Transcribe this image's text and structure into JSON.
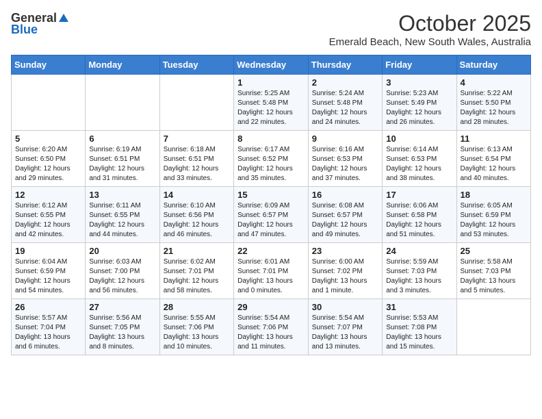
{
  "logo": {
    "general": "General",
    "blue": "Blue"
  },
  "title": {
    "month": "October 2025",
    "location": "Emerald Beach, New South Wales, Australia"
  },
  "headers": [
    "Sunday",
    "Monday",
    "Tuesday",
    "Wednesday",
    "Thursday",
    "Friday",
    "Saturday"
  ],
  "weeks": [
    [
      {
        "day": "",
        "info": ""
      },
      {
        "day": "",
        "info": ""
      },
      {
        "day": "",
        "info": ""
      },
      {
        "day": "1",
        "info": "Sunrise: 5:25 AM\nSunset: 5:48 PM\nDaylight: 12 hours\nand 22 minutes."
      },
      {
        "day": "2",
        "info": "Sunrise: 5:24 AM\nSunset: 5:48 PM\nDaylight: 12 hours\nand 24 minutes."
      },
      {
        "day": "3",
        "info": "Sunrise: 5:23 AM\nSunset: 5:49 PM\nDaylight: 12 hours\nand 26 minutes."
      },
      {
        "day": "4",
        "info": "Sunrise: 5:22 AM\nSunset: 5:50 PM\nDaylight: 12 hours\nand 28 minutes."
      }
    ],
    [
      {
        "day": "5",
        "info": "Sunrise: 6:20 AM\nSunset: 6:50 PM\nDaylight: 12 hours\nand 29 minutes."
      },
      {
        "day": "6",
        "info": "Sunrise: 6:19 AM\nSunset: 6:51 PM\nDaylight: 12 hours\nand 31 minutes."
      },
      {
        "day": "7",
        "info": "Sunrise: 6:18 AM\nSunset: 6:51 PM\nDaylight: 12 hours\nand 33 minutes."
      },
      {
        "day": "8",
        "info": "Sunrise: 6:17 AM\nSunset: 6:52 PM\nDaylight: 12 hours\nand 35 minutes."
      },
      {
        "day": "9",
        "info": "Sunrise: 6:16 AM\nSunset: 6:53 PM\nDaylight: 12 hours\nand 37 minutes."
      },
      {
        "day": "10",
        "info": "Sunrise: 6:14 AM\nSunset: 6:53 PM\nDaylight: 12 hours\nand 38 minutes."
      },
      {
        "day": "11",
        "info": "Sunrise: 6:13 AM\nSunset: 6:54 PM\nDaylight: 12 hours\nand 40 minutes."
      }
    ],
    [
      {
        "day": "12",
        "info": "Sunrise: 6:12 AM\nSunset: 6:55 PM\nDaylight: 12 hours\nand 42 minutes."
      },
      {
        "day": "13",
        "info": "Sunrise: 6:11 AM\nSunset: 6:55 PM\nDaylight: 12 hours\nand 44 minutes."
      },
      {
        "day": "14",
        "info": "Sunrise: 6:10 AM\nSunset: 6:56 PM\nDaylight: 12 hours\nand 46 minutes."
      },
      {
        "day": "15",
        "info": "Sunrise: 6:09 AM\nSunset: 6:57 PM\nDaylight: 12 hours\nand 47 minutes."
      },
      {
        "day": "16",
        "info": "Sunrise: 6:08 AM\nSunset: 6:57 PM\nDaylight: 12 hours\nand 49 minutes."
      },
      {
        "day": "17",
        "info": "Sunrise: 6:06 AM\nSunset: 6:58 PM\nDaylight: 12 hours\nand 51 minutes."
      },
      {
        "day": "18",
        "info": "Sunrise: 6:05 AM\nSunset: 6:59 PM\nDaylight: 12 hours\nand 53 minutes."
      }
    ],
    [
      {
        "day": "19",
        "info": "Sunrise: 6:04 AM\nSunset: 6:59 PM\nDaylight: 12 hours\nand 54 minutes."
      },
      {
        "day": "20",
        "info": "Sunrise: 6:03 AM\nSunset: 7:00 PM\nDaylight: 12 hours\nand 56 minutes."
      },
      {
        "day": "21",
        "info": "Sunrise: 6:02 AM\nSunset: 7:01 PM\nDaylight: 12 hours\nand 58 minutes."
      },
      {
        "day": "22",
        "info": "Sunrise: 6:01 AM\nSunset: 7:01 PM\nDaylight: 13 hours\nand 0 minutes."
      },
      {
        "day": "23",
        "info": "Sunrise: 6:00 AM\nSunset: 7:02 PM\nDaylight: 13 hours\nand 1 minute."
      },
      {
        "day": "24",
        "info": "Sunrise: 5:59 AM\nSunset: 7:03 PM\nDaylight: 13 hours\nand 3 minutes."
      },
      {
        "day": "25",
        "info": "Sunrise: 5:58 AM\nSunset: 7:03 PM\nDaylight: 13 hours\nand 5 minutes."
      }
    ],
    [
      {
        "day": "26",
        "info": "Sunrise: 5:57 AM\nSunset: 7:04 PM\nDaylight: 13 hours\nand 6 minutes."
      },
      {
        "day": "27",
        "info": "Sunrise: 5:56 AM\nSunset: 7:05 PM\nDaylight: 13 hours\nand 8 minutes."
      },
      {
        "day": "28",
        "info": "Sunrise: 5:55 AM\nSunset: 7:06 PM\nDaylight: 13 hours\nand 10 minutes."
      },
      {
        "day": "29",
        "info": "Sunrise: 5:54 AM\nSunset: 7:06 PM\nDaylight: 13 hours\nand 11 minutes."
      },
      {
        "day": "30",
        "info": "Sunrise: 5:54 AM\nSunset: 7:07 PM\nDaylight: 13 hours\nand 13 minutes."
      },
      {
        "day": "31",
        "info": "Sunrise: 5:53 AM\nSunset: 7:08 PM\nDaylight: 13 hours\nand 15 minutes."
      },
      {
        "day": "",
        "info": ""
      }
    ]
  ]
}
